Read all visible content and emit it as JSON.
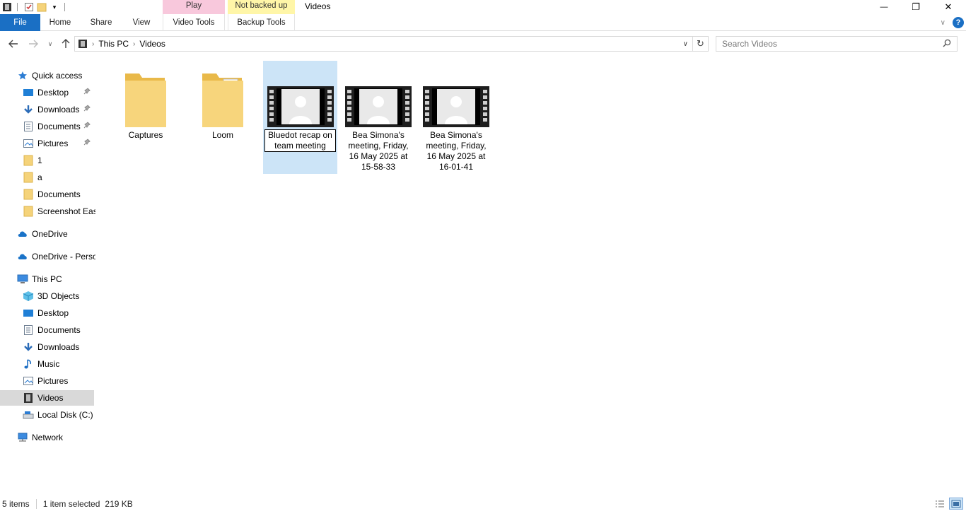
{
  "window": {
    "title": "Videos",
    "context_tabs": [
      "Play",
      "Not backed up"
    ],
    "controls": {
      "minimize": "—",
      "restore": "❐",
      "close": "✕"
    }
  },
  "ribbon": {
    "tabs": [
      "File",
      "Home",
      "Share",
      "View",
      "Video Tools",
      "Backup Tools"
    ]
  },
  "address": {
    "breadcrumb": [
      "This PC",
      "Videos"
    ],
    "search_placeholder": "Search Videos"
  },
  "nav": {
    "items": [
      {
        "label": "Quick access",
        "icon": "star-icon"
      },
      {
        "label": "Desktop",
        "icon": "desktop-icon",
        "pinned": true
      },
      {
        "label": "Downloads",
        "icon": "download-icon",
        "pinned": true
      },
      {
        "label": "Documents",
        "icon": "documents-icon",
        "pinned": true
      },
      {
        "label": "Pictures",
        "icon": "pictures-icon",
        "pinned": true
      },
      {
        "label": "1",
        "icon": "folder-icon"
      },
      {
        "label": "a",
        "icon": "folder-icon"
      },
      {
        "label": "Documents",
        "icon": "folder-icon"
      },
      {
        "label": "Screenshot Easy",
        "icon": "folder-icon"
      },
      {
        "label": "OneDrive",
        "icon": "cloud-icon"
      },
      {
        "label": "OneDrive - Perso",
        "icon": "cloud-icon"
      },
      {
        "label": "This PC",
        "icon": "computer-icon"
      },
      {
        "label": "3D Objects",
        "icon": "cube-icon"
      },
      {
        "label": "Desktop",
        "icon": "desktop-icon"
      },
      {
        "label": "Documents",
        "icon": "documents-icon"
      },
      {
        "label": "Downloads",
        "icon": "download-icon"
      },
      {
        "label": "Music",
        "icon": "music-icon"
      },
      {
        "label": "Pictures",
        "icon": "pictures-icon"
      },
      {
        "label": "Videos",
        "icon": "film-icon",
        "selected": true
      },
      {
        "label": "Local Disk (C:)",
        "icon": "drive-icon"
      },
      {
        "label": "Network",
        "icon": "network-icon"
      }
    ]
  },
  "files": [
    {
      "name": "Captures",
      "type": "folder"
    },
    {
      "name": "Loom",
      "type": "folder"
    },
    {
      "name": "Bluedot recap on team meeting",
      "type": "video",
      "selected": true
    },
    {
      "name": "Bea Simona's meeting, Friday, 16 May 2025 at 15-58-33",
      "type": "video"
    },
    {
      "name": "Bea Simona's meeting, Friday, 16 May 2025 at 16-01-41",
      "type": "video"
    }
  ],
  "status": {
    "item_count": "5 items",
    "selection": "1 item selected",
    "size": "219 KB"
  }
}
